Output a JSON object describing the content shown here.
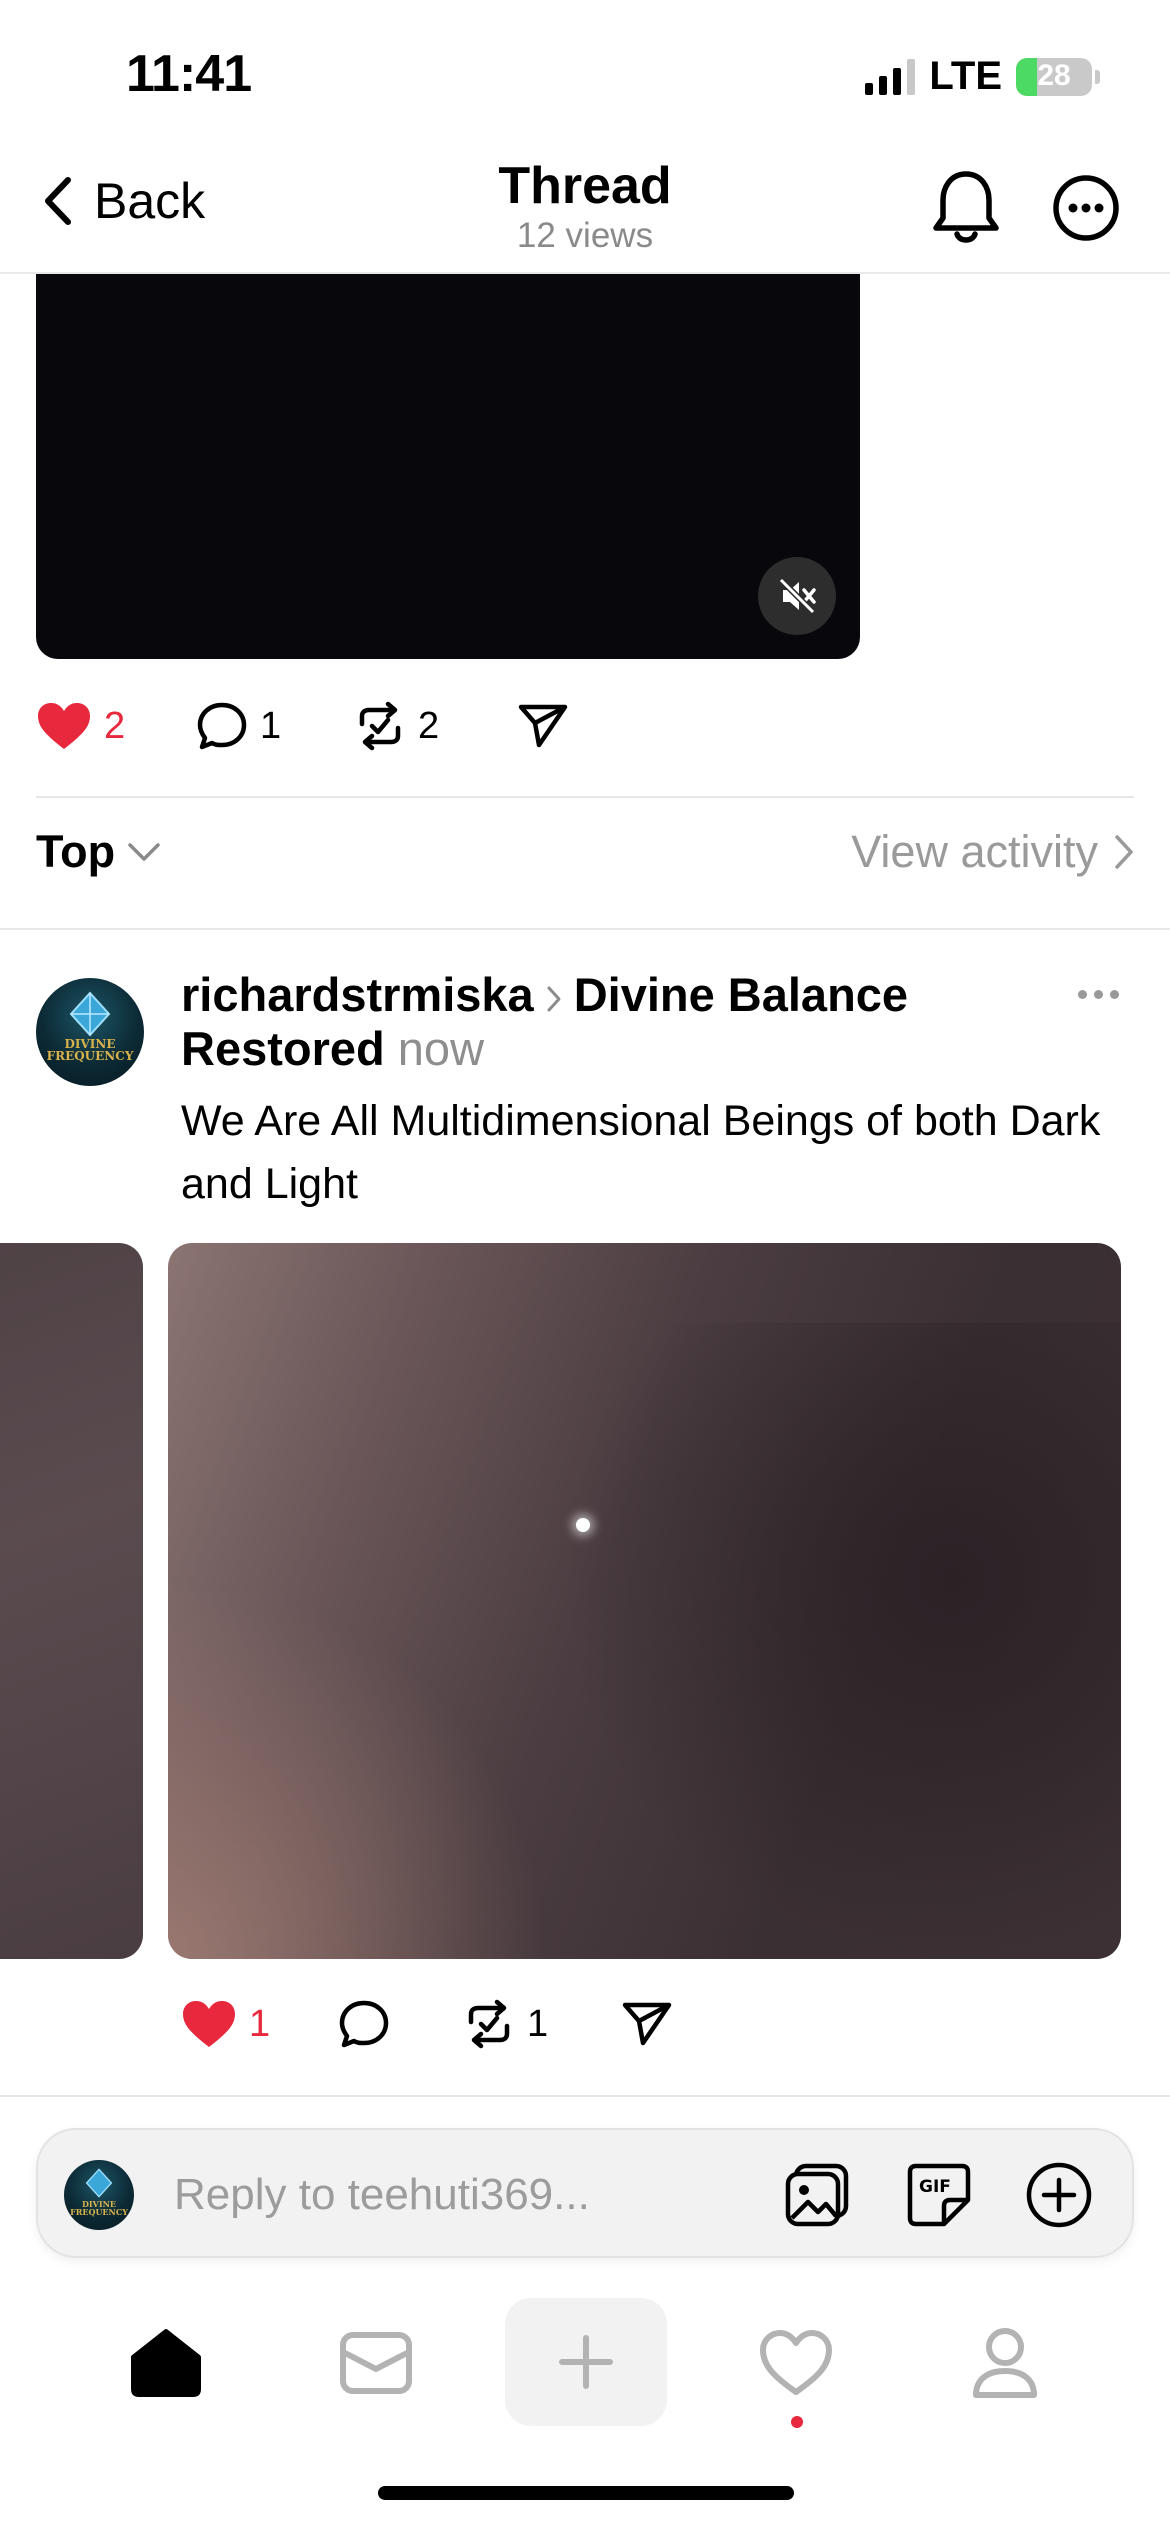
{
  "status_bar": {
    "time": "11:41",
    "network": "LTE",
    "battery": "28",
    "battery_level": 0.28
  },
  "nav": {
    "back_label": "Back",
    "title": "Thread",
    "subtitle": "12 views"
  },
  "main_post": {
    "likes": "2",
    "comments": "1",
    "reposts": "2"
  },
  "sort": {
    "label": "Top",
    "view_activity": "View activity"
  },
  "reply": {
    "avatar_text": "DIVINE FREQUENCY",
    "author": "richardstrmiska",
    "topic": "Divine Balance Restored",
    "time": "now",
    "text": "We Are All Multidimensional Beings of both Dark and Light",
    "likes": "1",
    "reposts": "1"
  },
  "composer": {
    "placeholder": "Reply to teehuti369..."
  },
  "tabs": [
    "home",
    "inbox",
    "compose",
    "activity",
    "profile"
  ],
  "colors": {
    "like_red": "#e8283d",
    "muted_gray": "#8e8e8e",
    "teal_avatar": "#0c2a35",
    "gold": "#d9b24a"
  }
}
